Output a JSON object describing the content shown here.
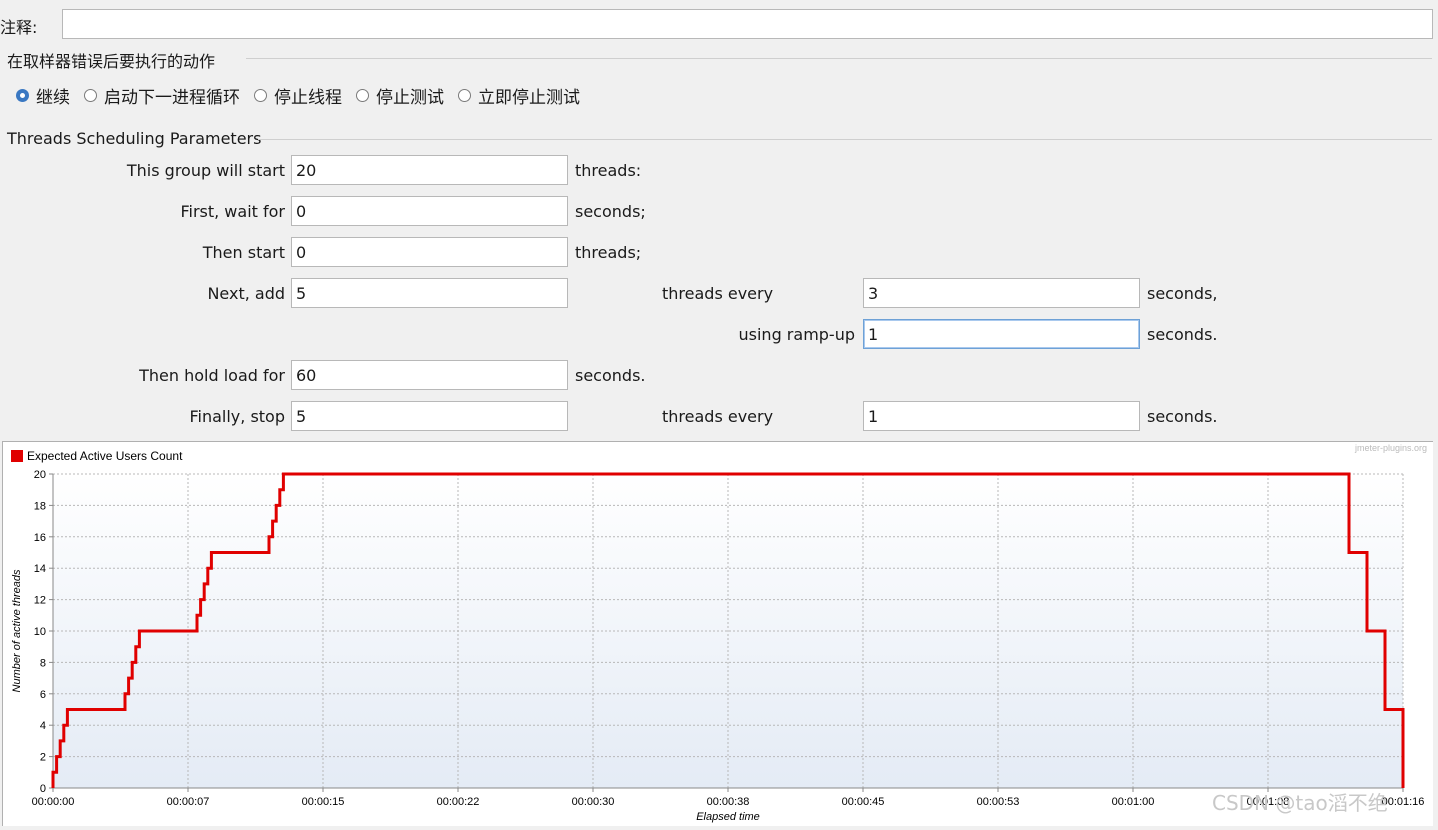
{
  "comment": {
    "label": "注释:",
    "value": ""
  },
  "on_error": {
    "title": "在取样器错误后要执行的动作",
    "options": [
      "继续",
      "启动下一进程循环",
      "停止线程",
      "停止测试",
      "立即停止测试"
    ],
    "selected": "继续"
  },
  "params": {
    "title": "Threads Scheduling Parameters",
    "start_label": "This group will start",
    "start_value": "20",
    "start_unit": "threads:",
    "wait_label": "First, wait for",
    "wait_value": "0",
    "wait_unit": "seconds;",
    "then_start_label": "Then start",
    "then_start_value": "0",
    "then_start_unit": "threads;",
    "next_add_label": "Next, add",
    "next_add_value": "5",
    "next_add_mid": "threads every",
    "next_add_every_value": "3",
    "next_add_unit": "seconds,",
    "rampup_label": "using ramp-up",
    "rampup_value": "1",
    "rampup_unit": "seconds.",
    "hold_label": "Then hold load for",
    "hold_value": "60",
    "hold_unit": "seconds.",
    "stop_label": "Finally, stop",
    "stop_value": "5",
    "stop_mid": "threads every",
    "stop_every_value": "1",
    "stop_unit": "seconds."
  },
  "chart_data": {
    "type": "line",
    "legend": "Expected Active Users Count",
    "credit": "jmeter-plugins.org",
    "xlabel": "Elapsed time",
    "ylabel": "Number of active threads",
    "series_color": "#e00000",
    "xlim": [
      0,
      75
    ],
    "ylim": [
      0,
      20
    ],
    "x_ticks": [
      "00:00:00",
      "00:00:07",
      "00:00:15",
      "00:00:22",
      "00:00:30",
      "00:00:38",
      "00:00:45",
      "00:00:53",
      "00:01:00",
      "00:01:08",
      "00:01:16"
    ],
    "y_ticks": [
      0,
      2,
      4,
      6,
      8,
      10,
      12,
      14,
      16,
      18,
      20
    ],
    "x": [
      0,
      0,
      0.2,
      0.2,
      0.4,
      0.4,
      0.6,
      0.6,
      0.8,
      0.8,
      1.0,
      4.0,
      4.0,
      4.2,
      4.2,
      4.4,
      4.4,
      4.6,
      4.6,
      4.8,
      4.8,
      8.0,
      8.0,
      8.2,
      8.2,
      8.4,
      8.4,
      8.6,
      8.6,
      8.8,
      8.8,
      12.0,
      12.0,
      12.2,
      12.2,
      12.4,
      12.4,
      12.6,
      12.6,
      12.8,
      12.8,
      72.0,
      72.0,
      73.0,
      73.0,
      74.0,
      74.0,
      75.0,
      75.0
    ],
    "y": [
      0,
      1,
      1,
      2,
      2,
      3,
      3,
      4,
      4,
      5,
      5,
      5,
      6,
      6,
      7,
      7,
      8,
      8,
      9,
      9,
      10,
      10,
      11,
      11,
      12,
      12,
      13,
      13,
      14,
      14,
      15,
      15,
      16,
      16,
      17,
      17,
      18,
      18,
      19,
      19,
      20,
      20,
      15,
      15,
      10,
      10,
      5,
      5,
      0
    ]
  },
  "watermark": "CSDN @tao滔不绝"
}
